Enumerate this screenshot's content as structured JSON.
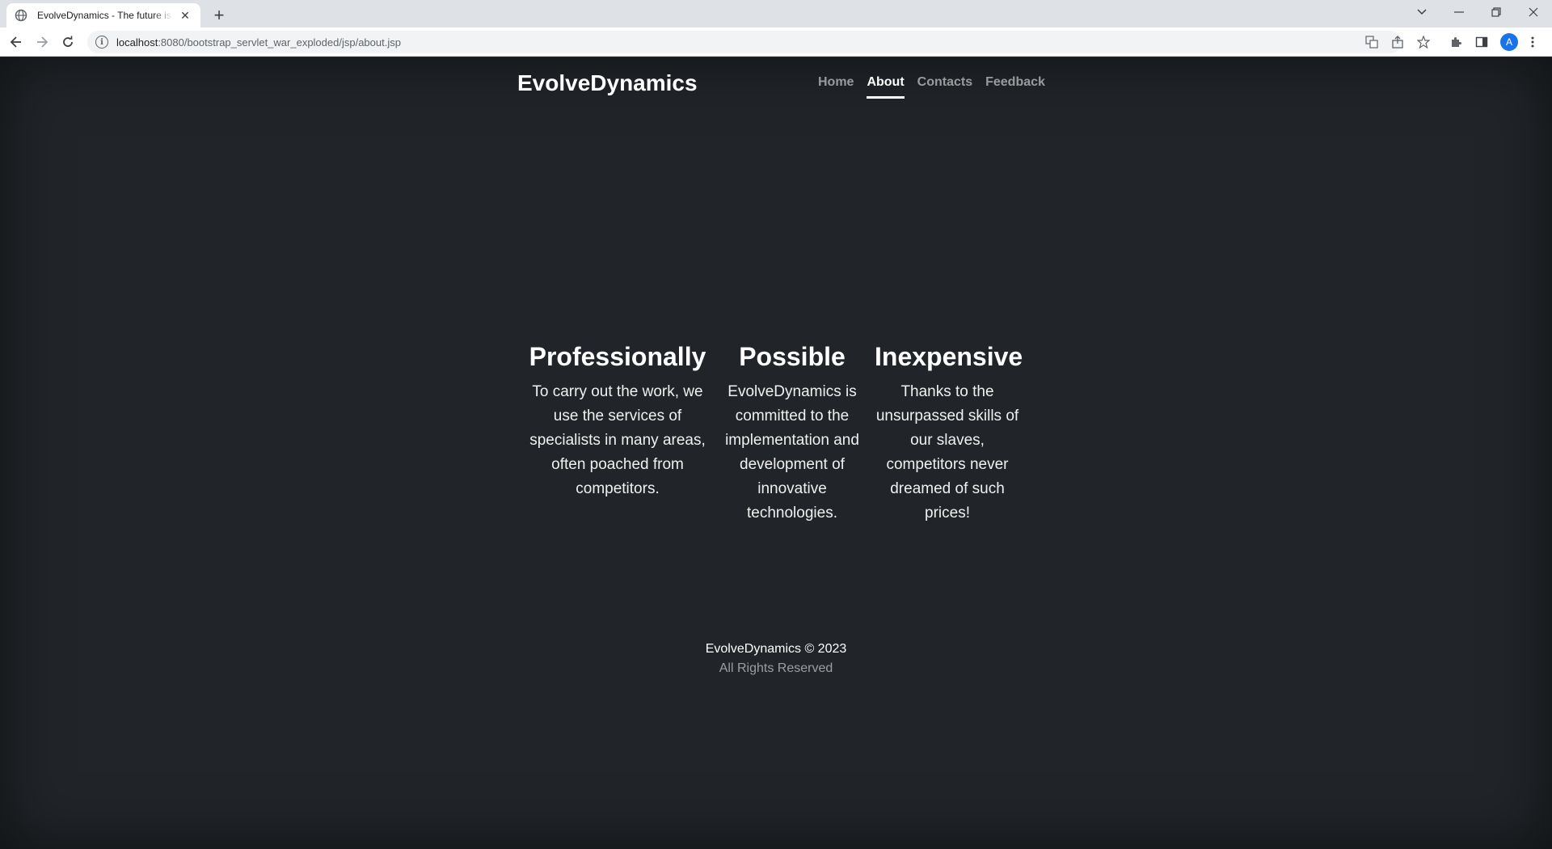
{
  "browser": {
    "tab_title": "EvolveDynamics - The future is already here",
    "url_host": "localhost",
    "url_path": ":8080/bootstrap_servlet_war_exploded/jsp/about.jsp",
    "avatar_letter": "A"
  },
  "navbar": {
    "brand": "EvolveDynamics",
    "links": [
      {
        "label": "Home",
        "active": false
      },
      {
        "label": "About",
        "active": true
      },
      {
        "label": "Contacts",
        "active": false
      },
      {
        "label": "Feedback",
        "active": false
      }
    ]
  },
  "features": [
    {
      "title": "Professionally",
      "text": "To carry out the work, we use the services of specialists in many areas, often poached from competitors."
    },
    {
      "title": "Possible",
      "text": "EvolveDynamics is committed to the implementation and development of innovative technologies."
    },
    {
      "title": "Inexpensive",
      "text": "Thanks to the unsurpassed skills of our slaves, competitors never dreamed of such prices!"
    }
  ],
  "footer": {
    "copyright": "EvolveDynamics © 2023",
    "rights": "All Rights Reserved"
  },
  "colors": {
    "page_bg": "#212529",
    "text": "#ffffff",
    "muted_text": "rgba(255,255,255,0.55)"
  }
}
